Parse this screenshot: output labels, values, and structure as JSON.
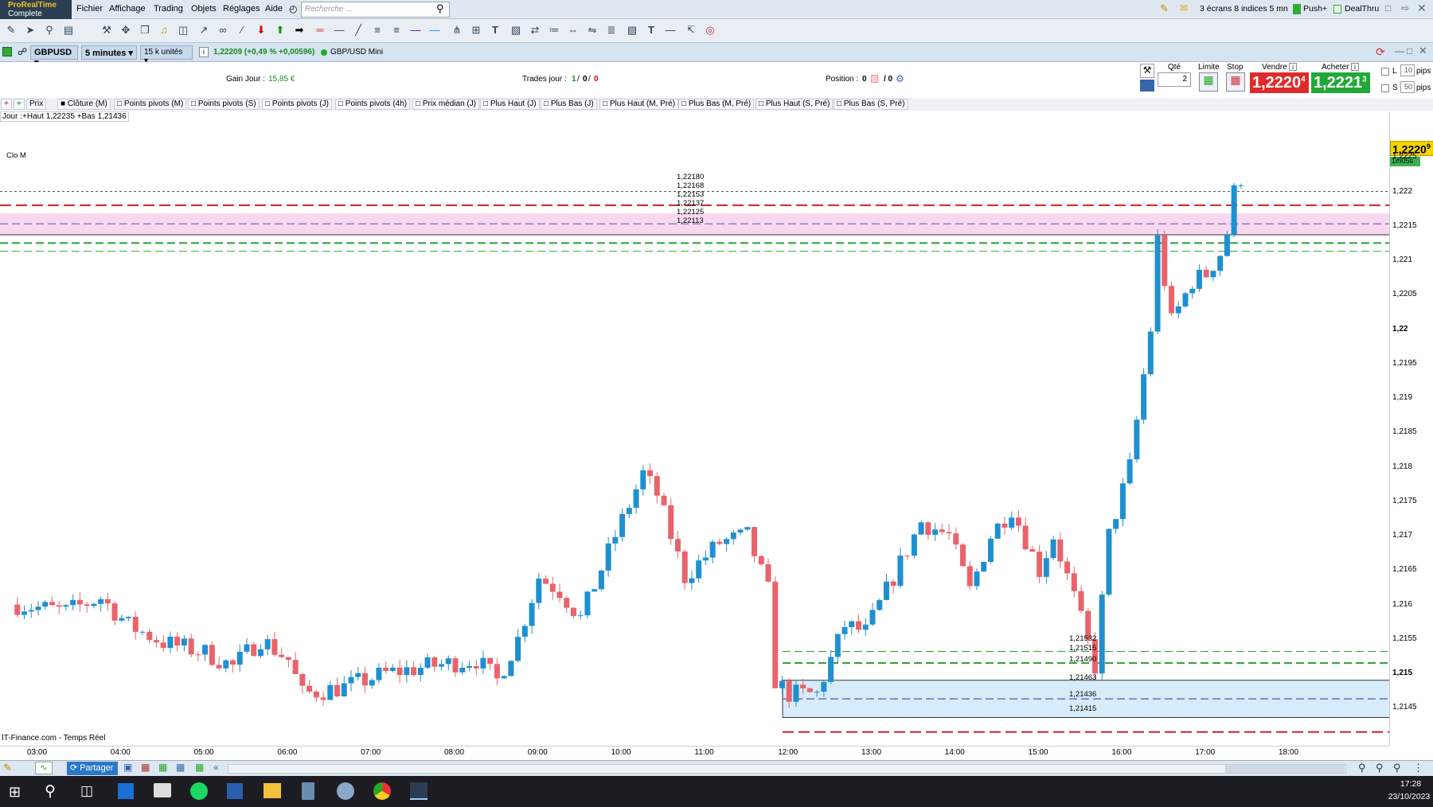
{
  "app": {
    "logo_line1": "ProRealTime",
    "logo_line2": "Complete"
  },
  "menu": [
    "Fichier",
    "Affichage",
    "Trading",
    "Objets",
    "Réglages",
    "Aide"
  ],
  "search": {
    "placeholder": "Recherche ..."
  },
  "top_right": {
    "screens": "3 écrans 8 indices 5 mn",
    "push": "Push+",
    "dealthru": "DealThru"
  },
  "instrument": {
    "symbol": "GBPUSD",
    "timeframe": "5 minutes",
    "units": "15 k unités",
    "quote": "1,22209 (+0,49 % +0,00596)",
    "name": "GBP/USD Mini"
  },
  "info": {
    "gain_label": "Gain Jour :",
    "gain_value": "15,85 €",
    "trades_label": "Trades jour :",
    "trades_a": "1",
    "trades_b": "0",
    "trades_c": "0",
    "position_label": "Position :",
    "position_value": "0",
    "position_extra": "/ 0",
    "qty_label": "Qté",
    "qty_value": "2",
    "limit_label": "Limite",
    "stop_label": "Stop",
    "sell_label": "Vendre",
    "sell_price": "1,2220",
    "sell_sup": "4",
    "buy_label": "Acheter",
    "buy_price": "1,2221",
    "buy_sup": "3",
    "l_label": "L",
    "l_pips": "10",
    "s_label": "S",
    "s_pips": "50",
    "pips": "pips"
  },
  "indicators": [
    "Prix",
    "Clôture (M)",
    "Points pivots (M)",
    "Points pivots (S)",
    "Points pivots (J)",
    "Points pivots (4h)",
    "Prix médian (J)",
    "Plus Haut (J)",
    "Plus Bas (J)",
    "Plus Haut (M, Pré)",
    "Plus Bas (M, Pré)",
    "Plus Haut (S, Pré)",
    "Plus Bas (S, Pré)"
  ],
  "day_info": "Jour :+Haut 1,22235 +Bas 1,21436",
  "clo_label": "Clo M",
  "source": "IT-Finance.com - Temps Réel",
  "level_labels_top": [
    "1,22180",
    "1,22168",
    "1,22153",
    "1,22137",
    "1,22125",
    "1,22113"
  ],
  "level_labels_bottom": [
    "1,21532",
    "1,21515",
    "1,21490",
    "1,21463",
    "1,21436",
    "1,21415"
  ],
  "price_tag": "1,2220",
  "price_tag_sup": "9",
  "timer_tag": "1m05s",
  "bottom": {
    "share": "Partager"
  },
  "clock": {
    "time": "17:28",
    "date": "23/10/2023"
  },
  "colors": {
    "bull": "#1e90d0",
    "bear": "#e8636b",
    "red_line": "#d42020",
    "green_line": "#2aa02a",
    "pink_zone": "#f8d8ef",
    "blue_zone": "#d6ecfa"
  },
  "chart_data": {
    "type": "candlestick",
    "x_ticks": [
      "03:00",
      "04:00",
      "05:00",
      "06:00",
      "07:00",
      "08:00",
      "09:00",
      "10:00",
      "11:00",
      "12:00",
      "13:00",
      "14:00",
      "15:00",
      "16:00",
      "17:00",
      "18:00"
    ],
    "y_ticks": [
      "1,2225",
      "1,222",
      "1,2215",
      "1,221",
      "1,2205",
      "1,22",
      "1,2195",
      "1,219",
      "1,2185",
      "1,218",
      "1,2175",
      "1,217",
      "1,2165",
      "1,216",
      "1,2155",
      "1,215",
      "1,2145"
    ],
    "ylim": [
      1.21395,
      1.22285
    ],
    "hlines": [
      {
        "y": 1.222,
        "style": "dotted",
        "color": "#555"
      },
      {
        "y": 1.2218,
        "style": "dashed",
        "color": "#d42020"
      },
      {
        "y": 1.22153,
        "style": "dashed",
        "color": "#5050c8"
      },
      {
        "y": 1.22137,
        "style": "solid",
        "color": "#333"
      },
      {
        "y": 1.22125,
        "style": "dashed",
        "color": "#2aa02a"
      },
      {
        "y": 1.22113,
        "style": "dashed",
        "color": "#2aa02a"
      },
      {
        "y": 1.21532,
        "style": "dashed",
        "color": "#2aa02a"
      },
      {
        "y": 1.21515,
        "style": "dashed",
        "color": "#2aa02a"
      },
      {
        "y": 1.2149,
        "style": "solid",
        "color": "#333"
      },
      {
        "y": 1.21463,
        "style": "dashed",
        "color": "#3030a0"
      },
      {
        "y": 1.21436,
        "style": "solid",
        "color": "#333"
      },
      {
        "y": 1.21415,
        "style": "dashed",
        "color": "#d42020"
      }
    ],
    "zones": [
      {
        "from": 1.22137,
        "to": 1.22168,
        "color": "#f8d8ef"
      },
      {
        "from": 1.21436,
        "to": 1.2149,
        "color": "#d6ecfa"
      }
    ],
    "anchors": [
      [
        "02:45",
        1.216
      ],
      [
        "03:20",
        1.2159
      ],
      [
        "03:45",
        1.2161
      ],
      [
        "04:05",
        1.2157
      ],
      [
        "04:30",
        1.21545
      ],
      [
        "05:00",
        1.2153
      ],
      [
        "05:20",
        1.2151
      ],
      [
        "05:40",
        1.2155
      ],
      [
        "06:00",
        1.2152
      ],
      [
        "06:10",
        1.2147
      ],
      [
        "06:40",
        1.2148
      ],
      [
        "07:10",
        1.215
      ],
      [
        "07:40",
        1.2151
      ],
      [
        "08:15",
        1.2152
      ],
      [
        "08:30",
        1.2149
      ],
      [
        "08:45",
        1.2155
      ],
      [
        "09:00",
        1.2164
      ],
      [
        "09:15",
        1.2162
      ],
      [
        "09:30",
        1.2158
      ],
      [
        "09:55",
        1.217
      ],
      [
        "10:15",
        1.2179
      ],
      [
        "10:25",
        1.2176
      ],
      [
        "10:45",
        1.2164
      ],
      [
        "11:10",
        1.2169
      ],
      [
        "11:30",
        1.217
      ],
      [
        "11:45",
        1.2162
      ],
      [
        "11:50",
        1.2149
      ],
      [
        "12:00",
        1.2147
      ],
      [
        "12:20",
        1.2147
      ],
      [
        "12:40",
        1.2157
      ],
      [
        "12:55",
        1.2156
      ],
      [
        "13:20",
        1.2166
      ],
      [
        "13:35",
        1.2172
      ],
      [
        "13:55",
        1.217
      ],
      [
        "14:10",
        1.2162
      ],
      [
        "14:25",
        1.217
      ],
      [
        "14:40",
        1.2174
      ],
      [
        "15:00",
        1.2165
      ],
      [
        "15:10",
        1.217
      ],
      [
        "15:25",
        1.2161
      ],
      [
        "15:40",
        1.2151
      ],
      [
        "15:50",
        1.217
      ],
      [
        "16:05",
        1.218
      ],
      [
        "16:20",
        1.22
      ],
      [
        "16:25",
        1.2213
      ],
      [
        "16:35",
        1.2201
      ],
      [
        "16:50",
        1.2207
      ],
      [
        "17:00",
        1.2208
      ],
      [
        "17:10",
        1.2211
      ],
      [
        "17:20",
        1.2217
      ],
      [
        "17:25",
        1.22209
      ]
    ]
  }
}
